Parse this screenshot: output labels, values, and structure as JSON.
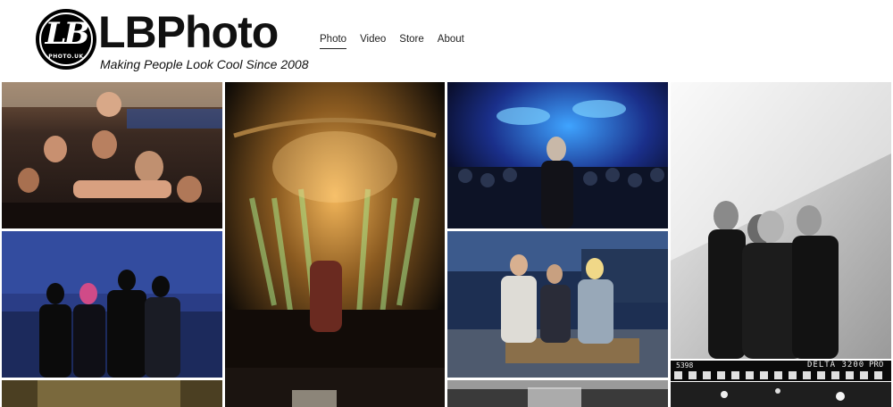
{
  "site": {
    "logo_monogram": "LB",
    "logo_small_text": "PHOTO.UK",
    "brand": "LBPhoto",
    "tagline": "Making People Look Cool Since 2008"
  },
  "nav": {
    "items": [
      {
        "label": "Photo",
        "active": true
      },
      {
        "label": "Video",
        "active": false
      },
      {
        "label": "Store",
        "active": false
      },
      {
        "label": "About",
        "active": false
      }
    ]
  },
  "gallery": {
    "film_strip": {
      "frame_number": "5398",
      "film_name": "DELTA 3200",
      "film_brand": "PRO"
    },
    "photos": [
      {
        "subject": "crowd-surfing audience"
      },
      {
        "subject": "concert stage light beams"
      },
      {
        "subject": "singer facing crowd, blue light"
      },
      {
        "subject": "band group portrait, black and white"
      },
      {
        "subject": "band portrait at night, blue"
      },
      {
        "subject": "band sitting on pallets at night"
      },
      {
        "subject": "warm hazy stage"
      },
      {
        "subject": "black and white live stage"
      },
      {
        "subject": "black and white stage lights"
      }
    ]
  }
}
